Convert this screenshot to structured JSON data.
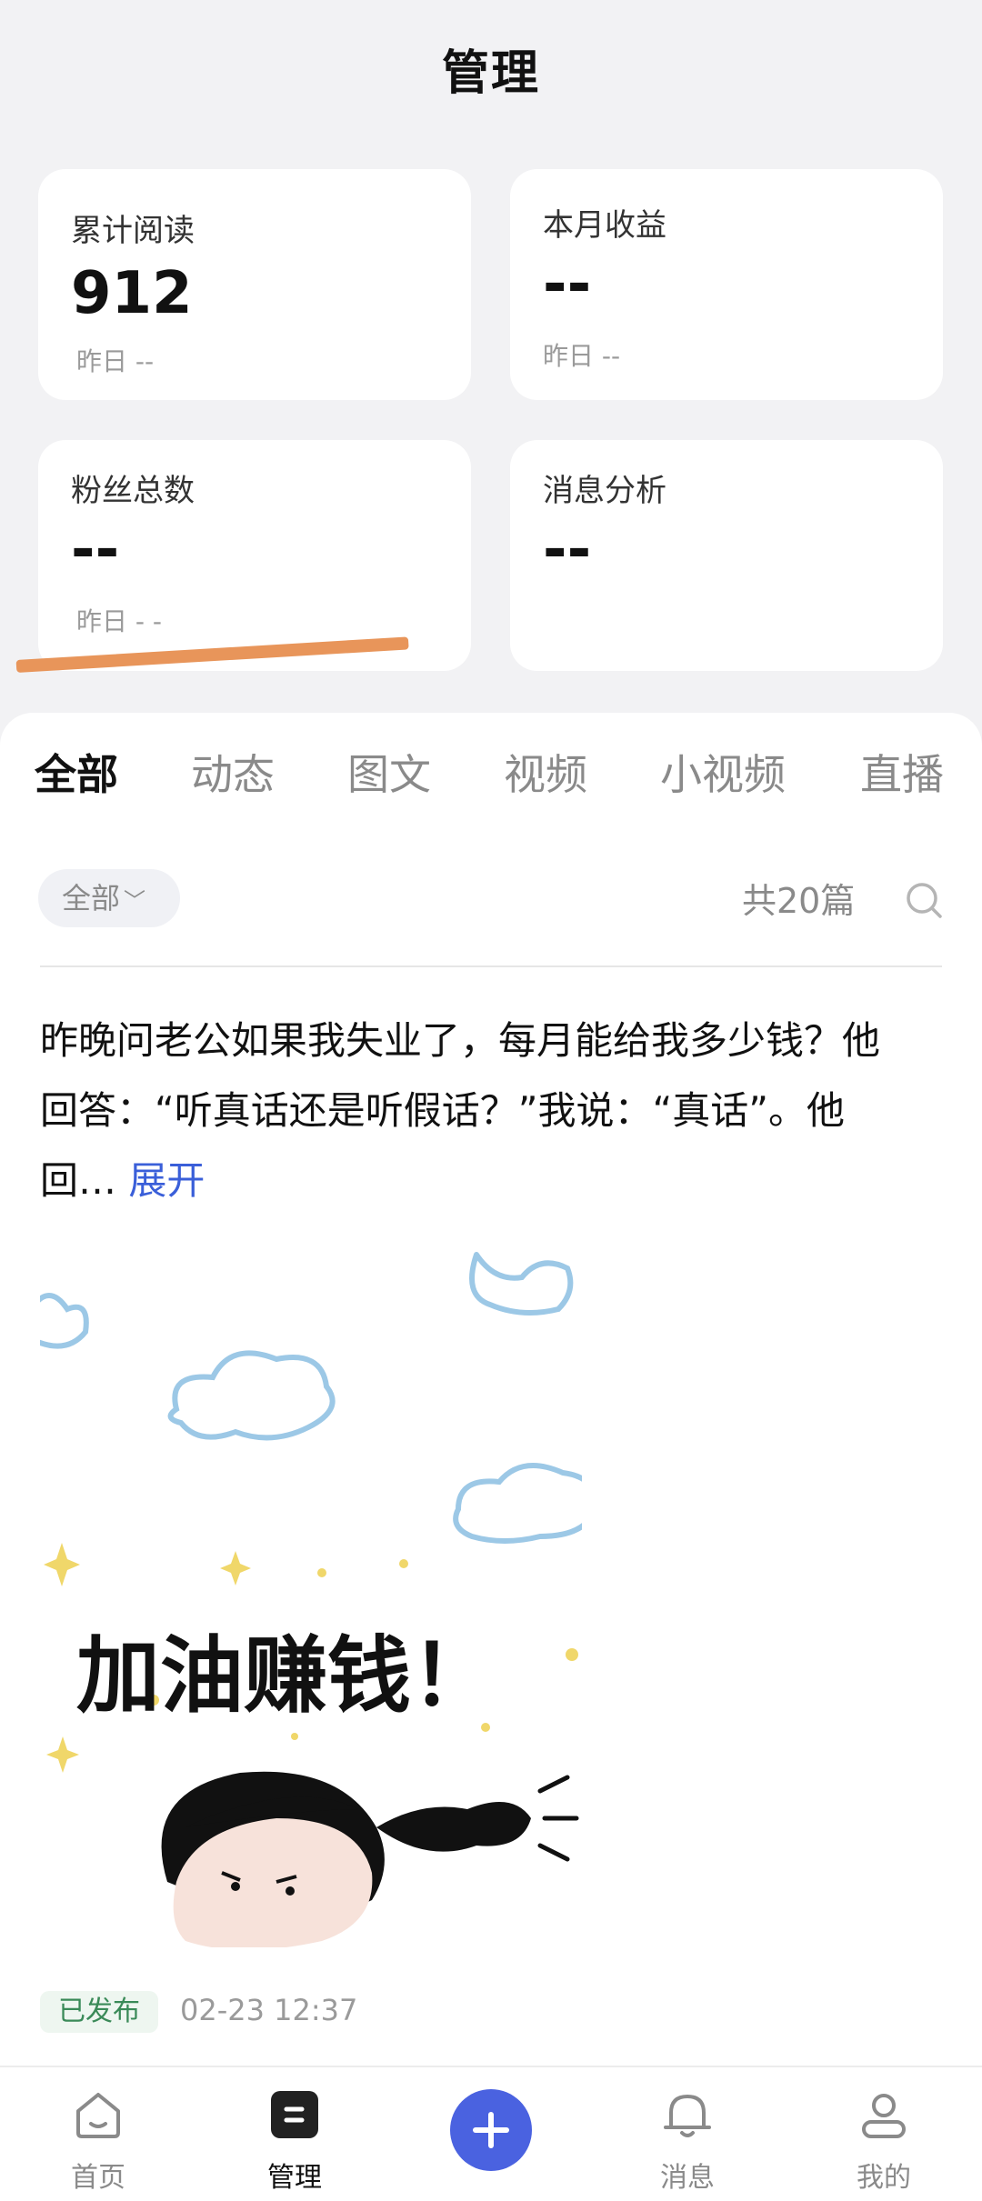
{
  "header": {
    "title": "管理"
  },
  "stats": [
    {
      "label": "累计阅读",
      "value": "912",
      "sub": "昨日 --"
    },
    {
      "label": "本月收益",
      "value": "--",
      "sub": "昨日 --"
    },
    {
      "label": "粉丝总数",
      "value": "--",
      "sub": "昨日 - -"
    },
    {
      "label": "消息分析",
      "value": "--"
    }
  ],
  "tabs": [
    "全部",
    "动态",
    "图文",
    "视频",
    "小视频",
    "直播"
  ],
  "filter": {
    "label": "全部",
    "count": "共20篇"
  },
  "post": {
    "text": "昨晚问老公如果我失业了，每月能给我多少钱？他回答：“听真话还是听假话？”我说：“真话”。他回…",
    "expand": "展开",
    "image_caption": "加油赚钱！",
    "status": "已发布",
    "time": "02-23 12:37"
  },
  "nav": [
    {
      "label": "首页",
      "icon": "home-icon"
    },
    {
      "label": "管理",
      "icon": "manage-icon"
    },
    {
      "label": "",
      "icon": "add-icon"
    },
    {
      "label": "消息",
      "icon": "bell-icon"
    },
    {
      "label": "我的",
      "icon": "profile-icon"
    }
  ],
  "colors": {
    "accent": "#4a62e0",
    "link": "#3a5fd9",
    "published": "#3a8a58",
    "highlight": "#e8955a"
  }
}
